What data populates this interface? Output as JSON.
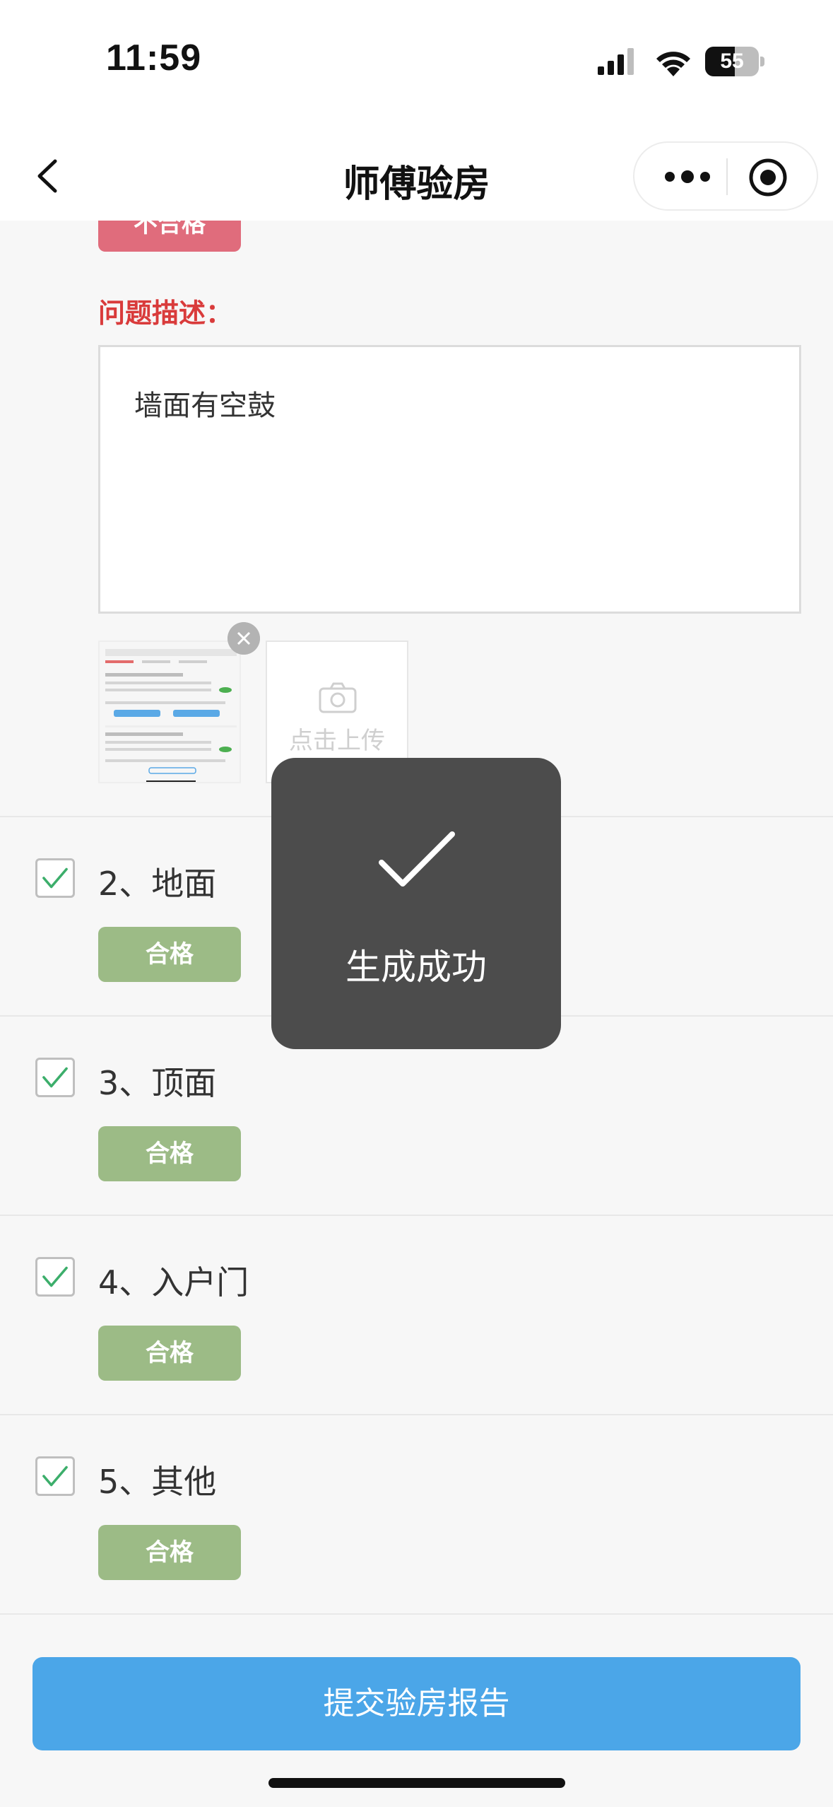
{
  "status_bar": {
    "time": "11:59",
    "battery_level": "55",
    "battery_fraction": 0.55
  },
  "nav": {
    "title": "师傅验房"
  },
  "current_item": {
    "status_label": "不合格",
    "issue_label": "问题描述：",
    "issue_text": "墙面有空鼓",
    "upload_label": "点击上传"
  },
  "items": [
    {
      "title": "2、地面",
      "status": "合格",
      "checked": true
    },
    {
      "title": "3、顶面",
      "status": "合格",
      "checked": true
    },
    {
      "title": "4、入户门",
      "status": "合格",
      "checked": true
    },
    {
      "title": "5、其他",
      "status": "合格",
      "checked": true
    }
  ],
  "toast": {
    "text": "生成成功"
  },
  "submit": {
    "label": "提交验房报告"
  },
  "colors": {
    "fail": "#e06c7c",
    "pass": "#9cbb86",
    "primary": "#4ba6e8",
    "check": "#3cae6b",
    "issue_label": "#d93b3b"
  }
}
